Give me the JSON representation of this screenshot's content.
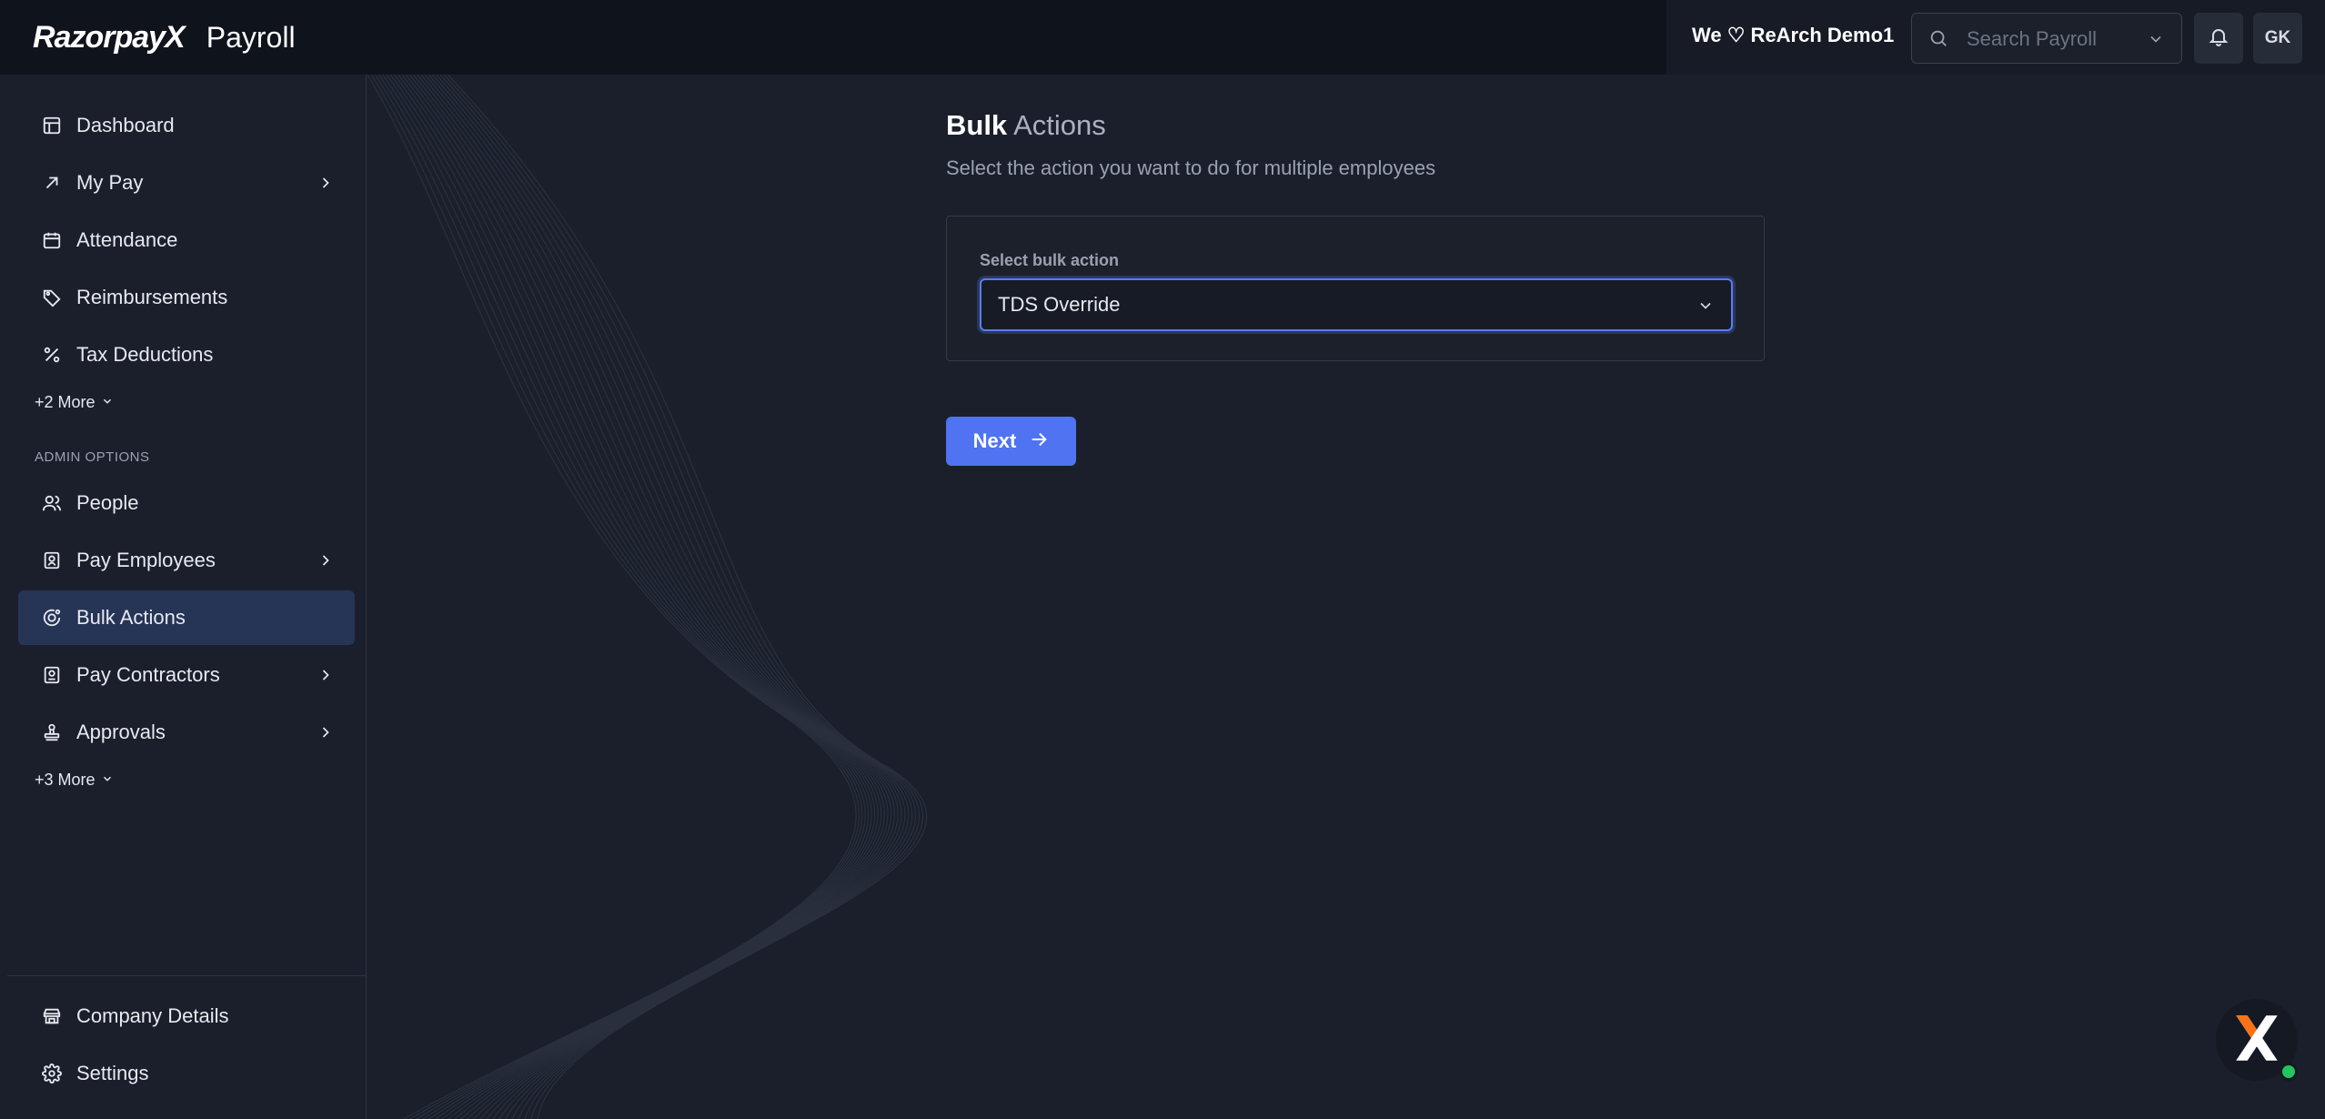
{
  "header": {
    "logo_text": "RazorpayX",
    "product": "Payroll",
    "org_name": "We ♡ ReArch Demo1",
    "search_placeholder": "Search Payroll",
    "avatar_initials": "GK"
  },
  "sidebar": {
    "items": [
      {
        "label": "Dashboard",
        "icon": "layout-icon"
      },
      {
        "label": "My Pay",
        "icon": "arrow-up-right-icon"
      },
      {
        "label": "Attendance",
        "icon": "calendar-icon"
      },
      {
        "label": "Reimbursements",
        "icon": "tag-icon"
      },
      {
        "label": "Tax Deductions",
        "icon": "percent-icon"
      }
    ],
    "more_1": "+2 More",
    "section_label": "ADMIN OPTIONS",
    "admin_items": [
      {
        "label": "People",
        "icon": "users-icon"
      },
      {
        "label": "Pay Employees",
        "icon": "receipt-icon"
      },
      {
        "label": "Bulk Actions",
        "icon": "bulk-icon",
        "active": true
      },
      {
        "label": "Pay Contractors",
        "icon": "contract-icon"
      },
      {
        "label": "Approvals",
        "icon": "stamp-icon"
      }
    ],
    "more_2": "+3 More",
    "bottom_items": [
      {
        "label": "Company Details",
        "icon": "building-icon"
      },
      {
        "label": "Settings",
        "icon": "gear-icon"
      }
    ]
  },
  "main": {
    "title_bold": "Bulk",
    "title_rest": "Actions",
    "subtitle": "Select the action you want to do for multiple employees",
    "field_label": "Select bulk action",
    "selected_action": "TDS Override",
    "next_label": "Next"
  },
  "colors": {
    "accent": "#4f73f1",
    "active_nav": "#263456",
    "background": "#1a1f2b"
  }
}
